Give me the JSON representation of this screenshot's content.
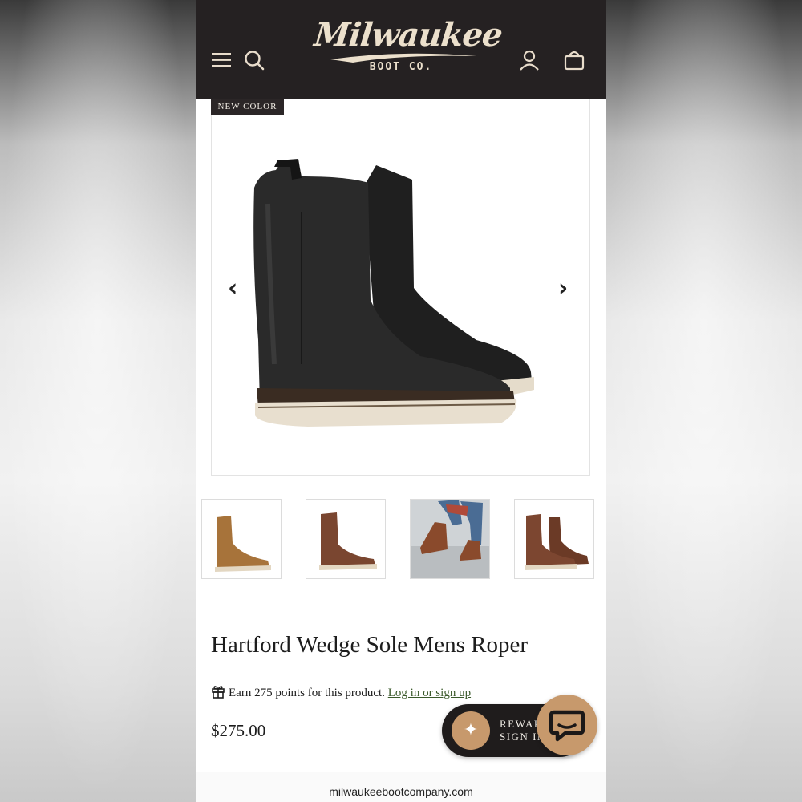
{
  "brand": {
    "name": "Milwaukee",
    "sub": "BOOT CO.",
    "colors": {
      "header_bg": "#252122",
      "logo": "#ece0cc",
      "accent": "#c7996c",
      "link": "#3b5a2b"
    }
  },
  "header": {
    "icons": [
      "hamburger-menu-icon",
      "search-icon",
      "account-icon",
      "shopping-bag-icon"
    ]
  },
  "product": {
    "badge": "NEW COLOR",
    "title": "Hartford Wedge Sole Mens Roper",
    "price": "$275.00",
    "points_text": "Earn 275 points for this product.",
    "points_link": "Log in or sign up",
    "gallery": {
      "prev": "‹",
      "next": "›",
      "thumbnails": [
        "tan-boot-thumbnail",
        "brown-boot-thumbnail",
        "lifestyle-photo-thumbnail",
        "pair-of-boots-thumbnail"
      ]
    }
  },
  "rewards": {
    "line1": "REWARD",
    "line2": "SIGN IN"
  },
  "browser": {
    "url": "milwaukeebootcompany.com"
  }
}
